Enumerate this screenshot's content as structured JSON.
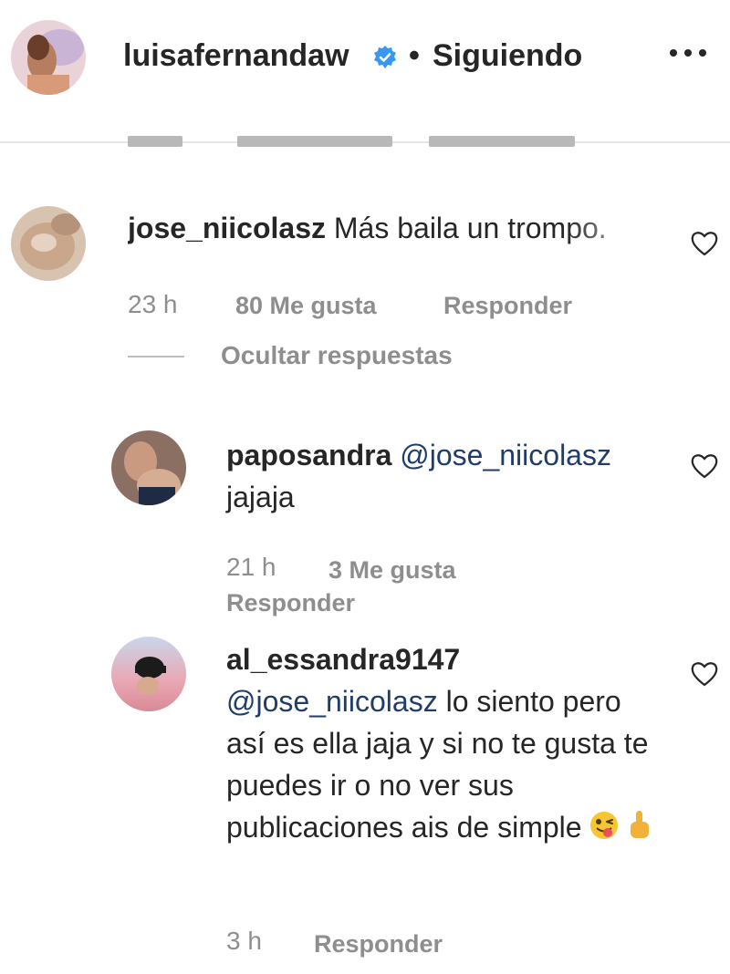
{
  "header": {
    "username": "luisafernandaw",
    "separator": "•",
    "follow_status": "Siguiendo",
    "verified_icon": "verified-badge-icon",
    "more_icon": "more-options-icon"
  },
  "comments": [
    {
      "username": "jose_niicolasz",
      "text": "Más baila un trompo.",
      "time": "23 h",
      "likes": "80 Me gusta",
      "reply_label": "Responder",
      "hide_replies": "Ocultar respuestas"
    }
  ],
  "replies": [
    {
      "username": "paposandra",
      "mention": "@jose_niicolasz",
      "text": "jajaja",
      "time": "21 h",
      "likes": "3 Me gusta",
      "reply_label": "Responder"
    },
    {
      "username": "al_essandra9147",
      "mention": "@jose_niicolasz",
      "text": "lo siento pero así es ella jaja y si no te gusta te puedes ir o no ver sus publicaciones ais de simple",
      "emojis": [
        "winking-face-tongue-emoji",
        "pointing-up-emoji"
      ],
      "time": "3 h",
      "reply_label": "Responder"
    }
  ],
  "colors": {
    "text": "#262626",
    "meta": "#8e8e8e",
    "mention": "#1f3d6b",
    "verified": "#3897f0",
    "divider": "#e6e6e6"
  }
}
